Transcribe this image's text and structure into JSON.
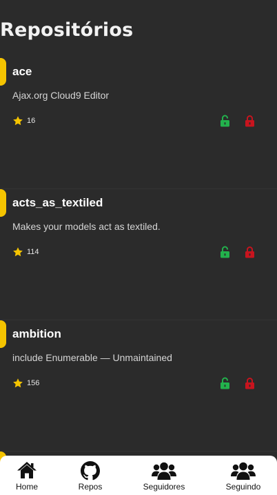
{
  "page": {
    "title": "Repositórios"
  },
  "colors": {
    "background": "#2b2b2b",
    "accent": "#f5c400",
    "star": "#f5c400",
    "unlocked": "#22b24c",
    "locked": "#c8141e",
    "nav_background": "#ffffff"
  },
  "repos": [
    {
      "name": "ace",
      "description": "Ajax.org Cloud9 Editor",
      "stars": "16"
    },
    {
      "name": "acts_as_textiled",
      "description": "Makes your models act as textiled.",
      "stars": "114"
    },
    {
      "name": "ambition",
      "description": "include Enumerable — Unmaintained",
      "stars": "156"
    }
  ],
  "nav": {
    "items": [
      {
        "label": "Home",
        "icon": "home-icon"
      },
      {
        "label": "Repos",
        "icon": "github-icon"
      },
      {
        "label": "Seguidores",
        "icon": "users-icon"
      },
      {
        "label": "Seguindo",
        "icon": "users-icon"
      }
    ]
  }
}
